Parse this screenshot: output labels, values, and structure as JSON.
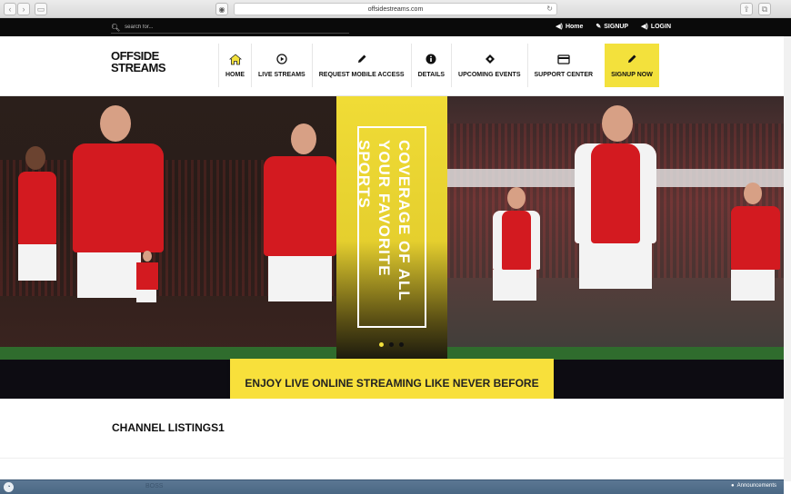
{
  "browser": {
    "url": "offsidestreams.com"
  },
  "topbar": {
    "search_placeholder": "search for...",
    "links": [
      {
        "label": "Home",
        "icon": "speaker-icon"
      },
      {
        "label": "SIGNUP",
        "icon": "pencil-icon"
      },
      {
        "label": "LOGIN",
        "icon": "speaker-icon"
      }
    ]
  },
  "logo": {
    "line1": "OFFSIDE",
    "line2": "STREAMS"
  },
  "nav": {
    "items": [
      {
        "label": "HOME",
        "icon": "home-icon"
      },
      {
        "label": "LIVE STREAMS",
        "icon": "play-icon"
      },
      {
        "label": "REQUEST MOBILE ACCESS",
        "icon": "pencil-icon"
      },
      {
        "label": "DETAILS",
        "icon": "info-icon"
      },
      {
        "label": "UPCOMING EVENTS",
        "icon": "ticket-icon"
      },
      {
        "label": "SUPPORT CENTER",
        "icon": "credit-card-icon"
      },
      {
        "label": "SIGNUP NOW",
        "icon": "pencil-icon"
      }
    ]
  },
  "hero": {
    "vertical_text": "COVERAGE OF ALL YOUR FAVORITE SPORTS",
    "slides": 3,
    "active_slide": 1
  },
  "cta": {
    "text": "ENJOY LIVE ONLINE STREAMING LIKE NEVER BEFORE"
  },
  "section": {
    "title": "CHANNEL LISTINGS1"
  },
  "bottombar": {
    "announcements": "Announcements",
    "faded_text": "BOSS"
  },
  "colors": {
    "accent": "#f3e13c",
    "dark": "#0a0a0a",
    "shirt_red": "#d31a20"
  }
}
